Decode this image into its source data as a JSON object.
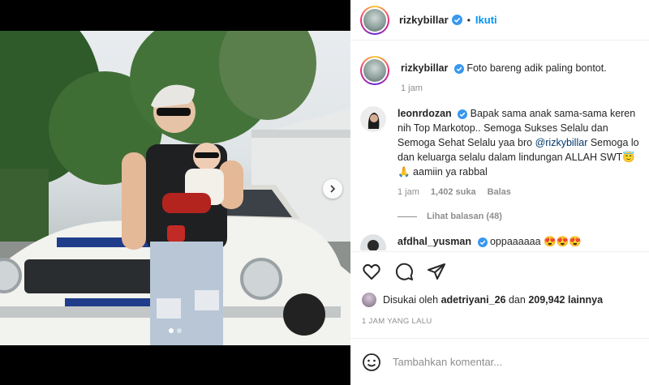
{
  "post": {
    "username": "rizkybillar",
    "follow_label": "Ikuti",
    "separator": "•"
  },
  "caption": {
    "username": "rizkybillar",
    "text": "Foto bareng adik paling bontot.",
    "time": "1 jam"
  },
  "comments": [
    {
      "username": "leonrdozan",
      "text_part1": "Bapak sama anak sama-sama keren nih Top Markotop.. Semoga Sukses Selalu dan Semoga Sehat Selalu yaa bro",
      "mention": "@rizkybillar",
      "text_part2": "Semoga lo dan keluarga selalu dalam lindungan ALLAH SWT😇🙏 aamiin ya rabbal",
      "time": "1 jam",
      "likes": "1,402 suka",
      "reply_label": "Balas",
      "view_replies": "Lihat balasan (48)"
    },
    {
      "username": "afdhal_yusman",
      "text": "oppaaaaaa 😍😍😍"
    }
  ],
  "actions": {
    "icons": [
      "heart-icon",
      "comment-icon",
      "share-icon"
    ]
  },
  "likes": {
    "prefix": "Disukai oleh",
    "user": "adetriyani_26",
    "and": "dan",
    "count": "209,942 lainnya"
  },
  "timestamp": "1 JAM YANG LALU",
  "add_comment": {
    "placeholder": "Tambahkan komentar..."
  },
  "colors": {
    "link_blue": "#0095f6",
    "verified_blue": "#3897f0",
    "text": "#262626",
    "muted": "#8e8e8e"
  }
}
